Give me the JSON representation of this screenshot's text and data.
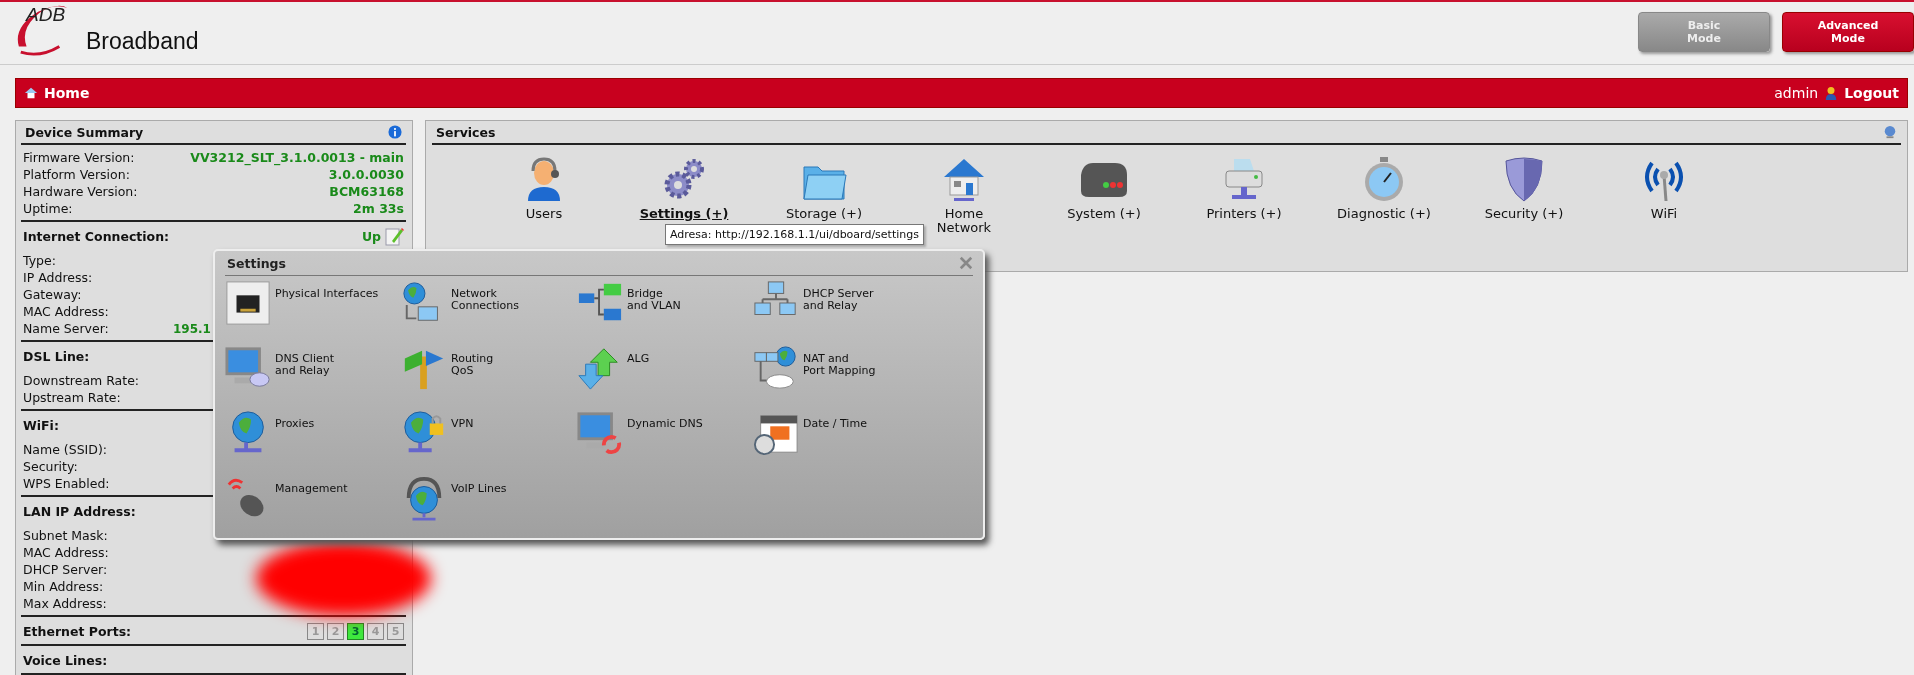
{
  "header": {
    "logo": {
      "mark": "ADB",
      "name": "Broadband"
    },
    "modes": [
      {
        "label": "Basic\nMode",
        "selected": false
      },
      {
        "label": "Advanced\nMode",
        "selected": true
      }
    ]
  },
  "nav_bar": {
    "title": "Home",
    "user": "admin",
    "logout": "Logout"
  },
  "device_summary": {
    "title": "Device Summary",
    "info_rows": [
      {
        "label": "Firmware Version:",
        "value": "VV3212_SLT_3.1.0.0013 - main"
      },
      {
        "label": "Platform Version:",
        "value": "3.0.0.0030"
      },
      {
        "label": "Hardware Version:",
        "value": "BCM63168"
      },
      {
        "label": "Uptime:",
        "value": "2m 33s"
      }
    ],
    "sections": [
      {
        "title": "Internet Connection:",
        "status": "Up",
        "editable": true,
        "rows": [
          {
            "label": "Type:"
          },
          {
            "label": "IP Address:"
          },
          {
            "label": "Gateway:"
          },
          {
            "label": "MAC Address:"
          },
          {
            "label": "Name Server:",
            "value": "195.1"
          }
        ]
      },
      {
        "title": "DSL Line:",
        "rows": [
          {
            "label": "Downstream Rate:"
          },
          {
            "label": "Upstream Rate:"
          }
        ]
      },
      {
        "title": "WiFi:",
        "rows": [
          {
            "label": "Name (SSID):"
          },
          {
            "label": "Security:"
          },
          {
            "label": "WPS Enabled:"
          }
        ]
      },
      {
        "title": "LAN IP Address:",
        "rows": [
          {
            "label": "Subnet Mask:"
          },
          {
            "label": "MAC Address:"
          },
          {
            "label": "DHCP Server:"
          },
          {
            "label": "Min Address:"
          },
          {
            "label": "Max Address:"
          }
        ]
      },
      {
        "title": "Ethernet Ports:",
        "editable": false,
        "ports": [
          {
            "label": "1",
            "on": false
          },
          {
            "label": "2",
            "on": false
          },
          {
            "label": "3",
            "on": true
          },
          {
            "label": "4",
            "on": false
          },
          {
            "label": "5",
            "on": false
          }
        ]
      },
      {
        "title": "Voice Lines:",
        "editable": false
      }
    ]
  },
  "services": {
    "title": "Services",
    "items": [
      {
        "label": "Users",
        "kind": "users",
        "selected": false
      },
      {
        "label": "Settings (+)",
        "kind": "settings",
        "selected": true
      },
      {
        "label": "Storage (+)",
        "kind": "storage",
        "selected": false
      },
      {
        "label": "Home\nNetwork",
        "kind": "home",
        "selected": false
      },
      {
        "label": "System (+)",
        "kind": "system",
        "selected": false
      },
      {
        "label": "Printers (+)",
        "kind": "printer",
        "selected": false
      },
      {
        "label": "Diagnostic (+)",
        "kind": "diagnostic",
        "selected": false
      },
      {
        "label": "Security (+)",
        "kind": "security",
        "selected": false
      },
      {
        "label": "WiFi",
        "kind": "wifi",
        "selected": false
      }
    ],
    "tooltip": "Adresa: http://192.168.1.1/ui/dboard/settings"
  },
  "settings_popup": {
    "title": "Settings",
    "items": [
      {
        "label": "Physical Interfaces",
        "kind": "port"
      },
      {
        "label": "Network\nConnections",
        "kind": "globe-pc"
      },
      {
        "label": "Bridge\nand VLAN",
        "kind": "bridge"
      },
      {
        "label": "DHCP Server\nand Relay",
        "kind": "computers"
      },
      {
        "label": "DNS Client\nand Relay",
        "kind": "monitor-chat"
      },
      {
        "label": "Routing\nQoS",
        "kind": "signpost"
      },
      {
        "label": "ALG",
        "kind": "arrows"
      },
      {
        "label": "NAT and\nPort Mapping",
        "kind": "nat"
      },
      {
        "label": "Proxies",
        "kind": "globe"
      },
      {
        "label": "VPN",
        "kind": "globe-lock"
      },
      {
        "label": "Dynamic DNS",
        "kind": "monitor-refresh"
      },
      {
        "label": "Date / Time",
        "kind": "calendar"
      },
      {
        "label": "Management",
        "kind": "mouse"
      },
      {
        "label": "VoIP Lines",
        "kind": "globe-headset"
      }
    ]
  }
}
